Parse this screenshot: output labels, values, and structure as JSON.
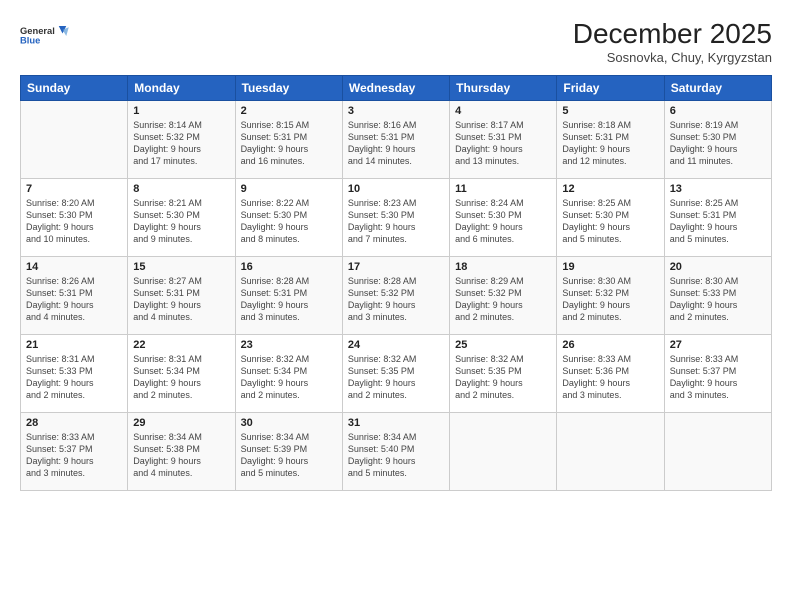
{
  "logo": {
    "line1": "General",
    "line2": "Blue"
  },
  "header": {
    "month": "December 2025",
    "location": "Sosnovka, Chuy, Kyrgyzstan"
  },
  "days_of_week": [
    "Sunday",
    "Monday",
    "Tuesday",
    "Wednesday",
    "Thursday",
    "Friday",
    "Saturday"
  ],
  "weeks": [
    [
      {
        "day": "",
        "info": ""
      },
      {
        "day": "1",
        "info": "Sunrise: 8:14 AM\nSunset: 5:32 PM\nDaylight: 9 hours\nand 17 minutes."
      },
      {
        "day": "2",
        "info": "Sunrise: 8:15 AM\nSunset: 5:31 PM\nDaylight: 9 hours\nand 16 minutes."
      },
      {
        "day": "3",
        "info": "Sunrise: 8:16 AM\nSunset: 5:31 PM\nDaylight: 9 hours\nand 14 minutes."
      },
      {
        "day": "4",
        "info": "Sunrise: 8:17 AM\nSunset: 5:31 PM\nDaylight: 9 hours\nand 13 minutes."
      },
      {
        "day": "5",
        "info": "Sunrise: 8:18 AM\nSunset: 5:31 PM\nDaylight: 9 hours\nand 12 minutes."
      },
      {
        "day": "6",
        "info": "Sunrise: 8:19 AM\nSunset: 5:30 PM\nDaylight: 9 hours\nand 11 minutes."
      }
    ],
    [
      {
        "day": "7",
        "info": "Sunrise: 8:20 AM\nSunset: 5:30 PM\nDaylight: 9 hours\nand 10 minutes."
      },
      {
        "day": "8",
        "info": "Sunrise: 8:21 AM\nSunset: 5:30 PM\nDaylight: 9 hours\nand 9 minutes."
      },
      {
        "day": "9",
        "info": "Sunrise: 8:22 AM\nSunset: 5:30 PM\nDaylight: 9 hours\nand 8 minutes."
      },
      {
        "day": "10",
        "info": "Sunrise: 8:23 AM\nSunset: 5:30 PM\nDaylight: 9 hours\nand 7 minutes."
      },
      {
        "day": "11",
        "info": "Sunrise: 8:24 AM\nSunset: 5:30 PM\nDaylight: 9 hours\nand 6 minutes."
      },
      {
        "day": "12",
        "info": "Sunrise: 8:25 AM\nSunset: 5:30 PM\nDaylight: 9 hours\nand 5 minutes."
      },
      {
        "day": "13",
        "info": "Sunrise: 8:25 AM\nSunset: 5:31 PM\nDaylight: 9 hours\nand 5 minutes."
      }
    ],
    [
      {
        "day": "14",
        "info": "Sunrise: 8:26 AM\nSunset: 5:31 PM\nDaylight: 9 hours\nand 4 minutes."
      },
      {
        "day": "15",
        "info": "Sunrise: 8:27 AM\nSunset: 5:31 PM\nDaylight: 9 hours\nand 4 minutes."
      },
      {
        "day": "16",
        "info": "Sunrise: 8:28 AM\nSunset: 5:31 PM\nDaylight: 9 hours\nand 3 minutes."
      },
      {
        "day": "17",
        "info": "Sunrise: 8:28 AM\nSunset: 5:32 PM\nDaylight: 9 hours\nand 3 minutes."
      },
      {
        "day": "18",
        "info": "Sunrise: 8:29 AM\nSunset: 5:32 PM\nDaylight: 9 hours\nand 2 minutes."
      },
      {
        "day": "19",
        "info": "Sunrise: 8:30 AM\nSunset: 5:32 PM\nDaylight: 9 hours\nand 2 minutes."
      },
      {
        "day": "20",
        "info": "Sunrise: 8:30 AM\nSunset: 5:33 PM\nDaylight: 9 hours\nand 2 minutes."
      }
    ],
    [
      {
        "day": "21",
        "info": "Sunrise: 8:31 AM\nSunset: 5:33 PM\nDaylight: 9 hours\nand 2 minutes."
      },
      {
        "day": "22",
        "info": "Sunrise: 8:31 AM\nSunset: 5:34 PM\nDaylight: 9 hours\nand 2 minutes."
      },
      {
        "day": "23",
        "info": "Sunrise: 8:32 AM\nSunset: 5:34 PM\nDaylight: 9 hours\nand 2 minutes."
      },
      {
        "day": "24",
        "info": "Sunrise: 8:32 AM\nSunset: 5:35 PM\nDaylight: 9 hours\nand 2 minutes."
      },
      {
        "day": "25",
        "info": "Sunrise: 8:32 AM\nSunset: 5:35 PM\nDaylight: 9 hours\nand 2 minutes."
      },
      {
        "day": "26",
        "info": "Sunrise: 8:33 AM\nSunset: 5:36 PM\nDaylight: 9 hours\nand 3 minutes."
      },
      {
        "day": "27",
        "info": "Sunrise: 8:33 AM\nSunset: 5:37 PM\nDaylight: 9 hours\nand 3 minutes."
      }
    ],
    [
      {
        "day": "28",
        "info": "Sunrise: 8:33 AM\nSunset: 5:37 PM\nDaylight: 9 hours\nand 3 minutes."
      },
      {
        "day": "29",
        "info": "Sunrise: 8:34 AM\nSunset: 5:38 PM\nDaylight: 9 hours\nand 4 minutes."
      },
      {
        "day": "30",
        "info": "Sunrise: 8:34 AM\nSunset: 5:39 PM\nDaylight: 9 hours\nand 5 minutes."
      },
      {
        "day": "31",
        "info": "Sunrise: 8:34 AM\nSunset: 5:40 PM\nDaylight: 9 hours\nand 5 minutes."
      },
      {
        "day": "",
        "info": ""
      },
      {
        "day": "",
        "info": ""
      },
      {
        "day": "",
        "info": ""
      }
    ]
  ]
}
